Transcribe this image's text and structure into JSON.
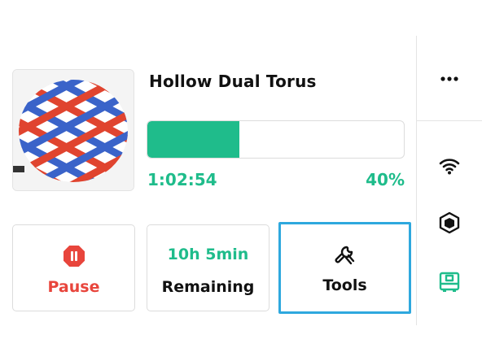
{
  "job": {
    "name": "Hollow Dual Torus",
    "elapsed": "1:02:54",
    "progress_percent_label": "40%",
    "progress_fraction": 0.36
  },
  "actions": {
    "pause_label": "Pause",
    "remaining_time": "10h 5min",
    "remaining_label": "Remaining",
    "tools_label": "Tools"
  },
  "sidebar": {
    "icons": [
      "more-icon",
      "wifi-icon",
      "cube-icon",
      "printer-icon"
    ]
  },
  "colors": {
    "accent": "#1fbc8b",
    "danger": "#e8453c",
    "focus": "#2ea8de"
  }
}
